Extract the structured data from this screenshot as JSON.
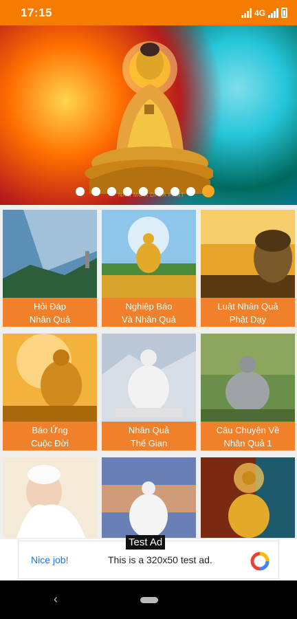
{
  "status": {
    "time": "17:15",
    "network": "4G"
  },
  "banner": {
    "caption": "NAM MÔ A DI ĐÀ PHẬT",
    "slide_count": 9,
    "active_index": 8
  },
  "tiles": [
    {
      "line1": "Hỏi Đáp",
      "line2": "Nhân Quả"
    },
    {
      "line1": "Nghiệp Báo",
      "line2": "Và Nhân Quả"
    },
    {
      "line1": "Luật Nhân Quả",
      "line2": "Phật Dạy"
    },
    {
      "line1": "Báo Ứng",
      "line2": "Cuộc Đời"
    },
    {
      "line1": "Nhân Quả",
      "line2": "Thế Gian"
    },
    {
      "line1": "Câu Chuyện Về",
      "line2": "Nhân Quả 1"
    }
  ],
  "ad": {
    "tag": "Test Ad",
    "headline": "Nice job!",
    "body": "This is a 320x50 test ad."
  },
  "colors": {
    "accent": "#f57c00",
    "tile_label": "#f0812a",
    "dot_active": "#f5a623"
  },
  "icons": {
    "back": "back-chevron-icon",
    "home": "home-pill-icon"
  }
}
